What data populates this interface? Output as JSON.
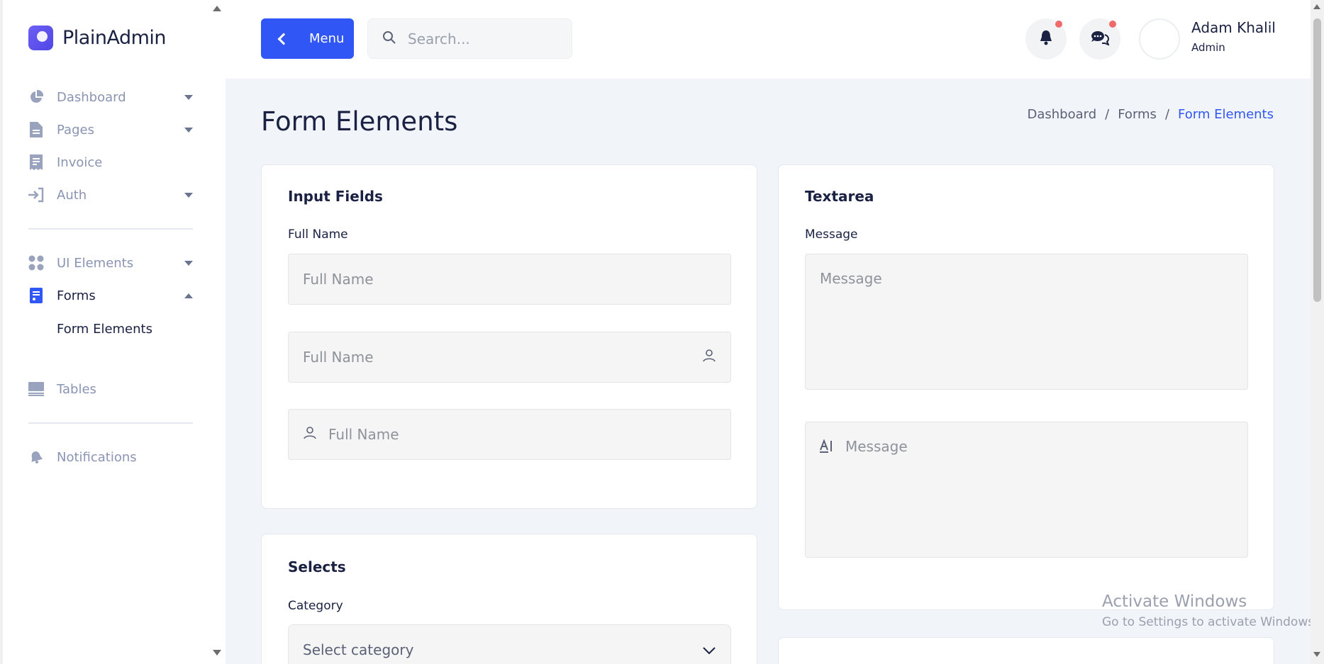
{
  "brand": {
    "name": "PlainAdmin"
  },
  "sidebar": {
    "items": [
      {
        "label": "Dashboard",
        "icon": "pie-chart-icon"
      },
      {
        "label": "Pages",
        "icon": "file-icon"
      },
      {
        "label": "Invoice",
        "icon": "receipt-icon"
      },
      {
        "label": "Auth",
        "icon": "login-icon"
      },
      {
        "label": "UI Elements",
        "icon": "grid-icon"
      },
      {
        "label": "Forms",
        "icon": "form-icon"
      },
      {
        "label": "Form Elements"
      },
      {
        "label": "Tables",
        "icon": "table-icon"
      },
      {
        "label": "Notifications",
        "icon": "bell-icon"
      }
    ]
  },
  "header": {
    "menu_label": "Menu",
    "search_placeholder": "Search...",
    "user_name": "Adam Khalil",
    "user_role": "Admin"
  },
  "page": {
    "title": "Form Elements",
    "breadcrumb": [
      "Dashboard",
      "/",
      "Forms",
      "/",
      "Form Elements"
    ]
  },
  "input_card": {
    "title": "Input Fields",
    "label": "Full Name",
    "placeholder": "Full Name"
  },
  "textarea_card": {
    "title": "Textarea",
    "label": "Message",
    "placeholder": "Message"
  },
  "selects_card": {
    "title": "Selects",
    "label": "Category",
    "selected": "Select category"
  },
  "watermark": {
    "line1": "Activate Windows",
    "line2": "Go to Settings to activate Windows."
  },
  "colors": {
    "accent": "#3056f5",
    "badge": "#f06a6a"
  }
}
